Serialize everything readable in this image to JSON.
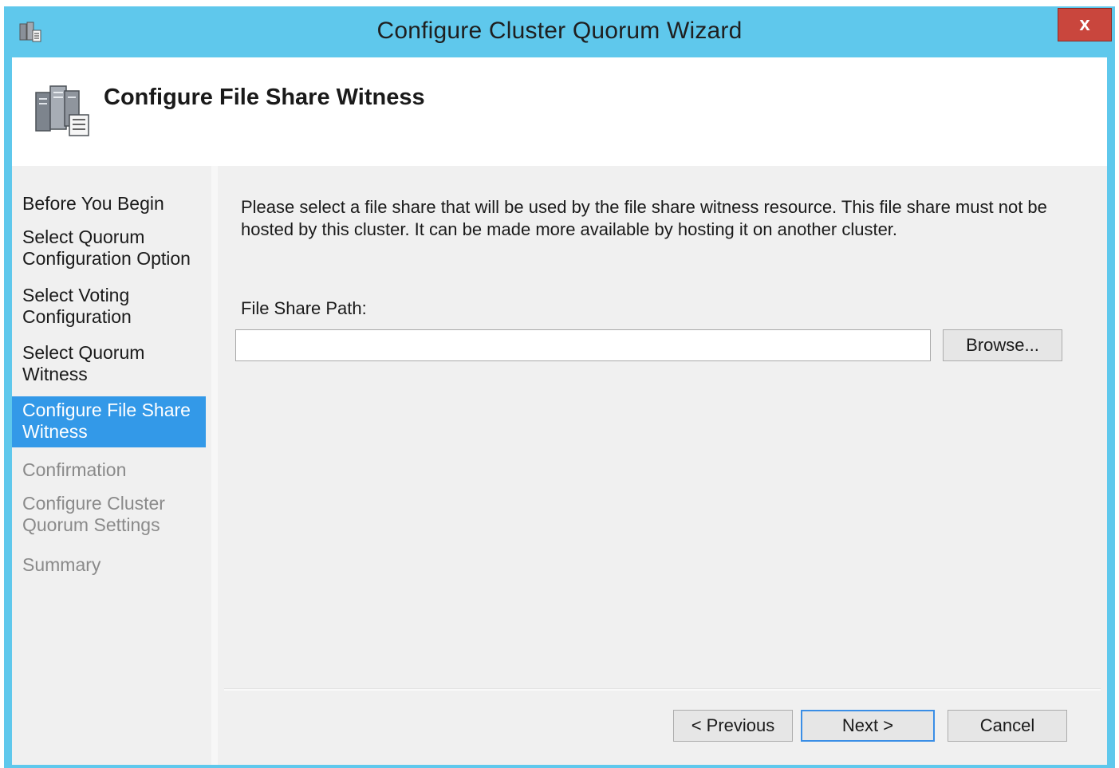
{
  "window": {
    "title": "Configure Cluster Quorum Wizard",
    "close_label": "x"
  },
  "header": {
    "title": "Configure File Share Witness"
  },
  "steps": [
    {
      "label": "Before You Begin",
      "state": "done"
    },
    {
      "label": "Select Quorum Configuration Option",
      "state": "done"
    },
    {
      "label": "Select Voting Configuration",
      "state": "done"
    },
    {
      "label": "Select Quorum Witness",
      "state": "done"
    },
    {
      "label": "Configure File Share Witness",
      "state": "current"
    },
    {
      "label": "Confirmation",
      "state": "pending"
    },
    {
      "label": "Configure Cluster Quorum Settings",
      "state": "pending"
    },
    {
      "label": "Summary",
      "state": "pending"
    }
  ],
  "main": {
    "description": "Please select a file share that will be used by the file share witness resource.  This file share must not be hosted by this cluster.  It can be made more available by hosting it on another cluster.",
    "path_label": "File Share Path:",
    "path_value": "",
    "browse_label": "Browse..."
  },
  "footer": {
    "previous_label": "< Previous",
    "next_label": "Next >",
    "cancel_label": "Cancel"
  },
  "colors": {
    "titlebar": "#5fc8ec",
    "close": "#c9463d",
    "current_step": "#3399e8"
  }
}
